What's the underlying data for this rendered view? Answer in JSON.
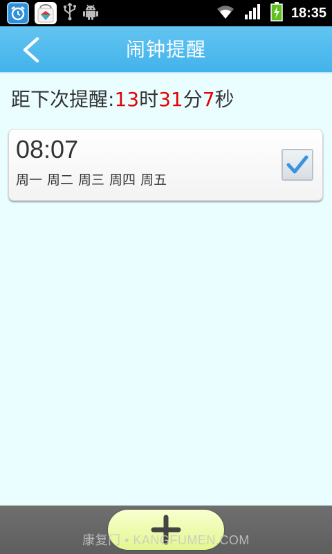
{
  "status_bar": {
    "time": "18:35",
    "icons": [
      "alarm-clock-icon",
      "app-store-icon",
      "usb-icon",
      "android-icon",
      "wifi-icon",
      "signal-icon",
      "battery-charging-icon"
    ]
  },
  "header": {
    "title": "闹钟提醒",
    "back_icon": "chevron-left-icon"
  },
  "countdown": {
    "prefix": "距下次提醒:",
    "hours": "13",
    "hours_unit": "时",
    "minutes": "31",
    "minutes_unit": "分",
    "seconds": "7",
    "seconds_unit": "秒"
  },
  "alarms": [
    {
      "time": "08:07",
      "days": [
        "周一",
        "周二",
        "周三",
        "周四",
        "周五"
      ],
      "enabled": true
    }
  ],
  "bottom": {
    "add_icon": "plus-icon",
    "watermark": "康复门 • KANGFUMEN.COM"
  },
  "colors": {
    "header": "#4bb9ee",
    "background": "#eafeff",
    "countdown_number": "#e30000",
    "check": "#3a93e0",
    "add_button": "#eef9a9"
  }
}
